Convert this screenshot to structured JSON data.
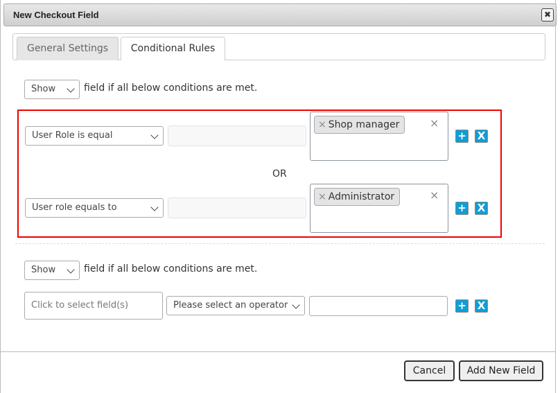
{
  "dialog": {
    "title": "New Checkout Field",
    "close_icon": "close-icon"
  },
  "tabs": [
    {
      "label": "General Settings",
      "active": false
    },
    {
      "label": "Conditional Rules",
      "active": true
    }
  ],
  "group1": {
    "action": "Show",
    "suffix": "field if all below conditions are met.",
    "rules": [
      {
        "field": "User Role is equal",
        "value": "",
        "selected": [
          "Shop manager"
        ]
      },
      {
        "field": "User role equals to",
        "value": "",
        "selected": [
          "Administrator"
        ]
      }
    ],
    "separator": "OR"
  },
  "group2": {
    "action": "Show",
    "suffix": "field if all below conditions are met.",
    "rule": {
      "field_placeholder": "Click to select field(s)",
      "operator": "Please select an operator",
      "value": ""
    }
  },
  "buttons": {
    "add": "+",
    "remove": "X"
  },
  "footer": {
    "cancel": "Cancel",
    "submit": "Add New Field"
  },
  "colors": {
    "accent": "#0e9ed6",
    "highlight": "#e00000"
  }
}
